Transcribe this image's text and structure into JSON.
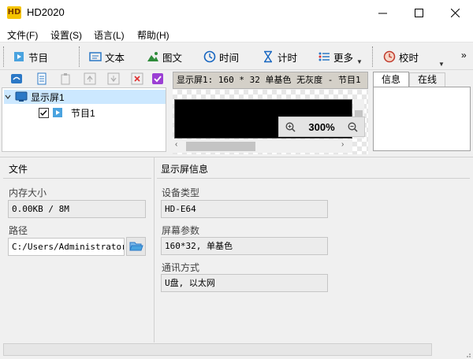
{
  "window": {
    "title": "HD2020",
    "app_icon_text": "HD"
  },
  "menu": [
    "文件(F)",
    "设置(S)",
    "语言(L)",
    "帮助(H)"
  ],
  "toolbar": {
    "program": "节目",
    "text": "文本",
    "image": "图文",
    "time": "时间",
    "timer": "计时",
    "more": "更多",
    "calibrate": "校时",
    "overflow": "»"
  },
  "tree": {
    "screen_label": "显示屏1",
    "program_label": "节目1",
    "program_checked": true
  },
  "preview": {
    "header": "显示屏1: 160 * 32 单基色 无灰度 - 节目1",
    "zoom": "300%"
  },
  "info_tabs": [
    "信息",
    "在线"
  ],
  "file_panel": {
    "title": "文件",
    "memory_label": "内存大小",
    "memory_value": "0.00KB / 8M",
    "path_label": "路径",
    "path_value": "C:/Users/Administrator/AppData"
  },
  "device_panel": {
    "title": "显示屏信息",
    "type_label": "设备类型",
    "type_value": "HD-E64",
    "params_label": "屏幕参数",
    "params_value": "160*32, 单基色",
    "comm_label": "通讯方式",
    "comm_value": "U盘, 以太网"
  },
  "colors": {
    "accent_blue": "#2b78c6",
    "tree_selected": "#cce8ff",
    "timer_blue": "#1565c0"
  }
}
